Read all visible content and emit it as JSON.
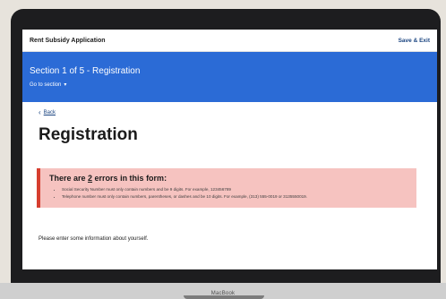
{
  "header": {
    "title": "Rent Subsidy Application",
    "save_exit": "Save & Exit"
  },
  "section": {
    "title": "Section 1 of 5 - Registration",
    "goto": "Go to section"
  },
  "nav": {
    "back": "Back"
  },
  "page": {
    "title": "Registration",
    "intro": "Please enter some information about yourself."
  },
  "errors": {
    "prefix": "There are ",
    "count": "2",
    "suffix": " errors in this form:",
    "items": [
      "Social Security Number must only contain numbers and be 9 digits. For example, 123456789",
      "Telephone number must only contain numbers, parentheses, or dashes and be 10 digits. For example, (313) 555-0019 or 3135550019."
    ]
  },
  "device": {
    "brand": "MacBook"
  },
  "colors": {
    "section_bar": "#2b6bd6",
    "error_bg": "#f6c3c0",
    "error_border": "#d63e2f"
  }
}
